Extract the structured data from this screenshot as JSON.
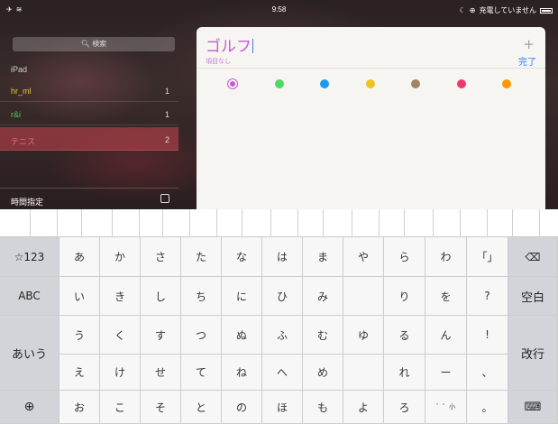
{
  "status_bar": {
    "time": "9:58",
    "charging": "充電していません"
  },
  "sidebar": {
    "search_placeholder": "検索",
    "section_label": "iPad",
    "lists": [
      {
        "name": "hr_ml",
        "count": "1",
        "color": "#e9c53a"
      },
      {
        "name": "r&i",
        "count": "1",
        "color": "#4fcb5a"
      },
      {
        "name": "テニス",
        "count": "2",
        "color": "#d75d7a"
      }
    ],
    "scheduled_label": "時間指定"
  },
  "editor": {
    "title": "ゴルフ",
    "subtitle": "項目なし",
    "add_symbol": "+",
    "done_label": "完了",
    "colors": [
      "#c45ad6",
      "#4cd964",
      "#1b9bf0",
      "#f0c21e",
      "#a2845e",
      "#f0386d",
      "#ff9500"
    ],
    "selected_color_index": 0
  },
  "keyboard": {
    "rows": [
      [
        "☆123",
        "あ",
        "か",
        "さ",
        "た",
        "な",
        "は",
        "ま",
        "や",
        "ら",
        "わ",
        "「」",
        "⌫"
      ],
      [
        "ABC",
        "い",
        "き",
        "し",
        "ち",
        "に",
        "ひ",
        "み",
        "",
        "り",
        "を",
        "?",
        "空白"
      ],
      [
        "あいう",
        "う",
        "く",
        "す",
        "つ",
        "ぬ",
        "ふ",
        "む",
        "ゆ",
        "る",
        "ん",
        "!",
        "改行"
      ],
      [
        "",
        "え",
        "け",
        "せ",
        "て",
        "ね",
        "へ",
        "め",
        "",
        "れ",
        "ー",
        "、",
        ""
      ],
      [
        "globe",
        "お",
        "こ",
        "そ",
        "と",
        "の",
        "ほ",
        "も",
        "よ",
        "ろ",
        "゛゜小",
        "。",
        "keyboard"
      ]
    ]
  },
  "colors": {
    "accent": "#2b7de9",
    "title_purple": "#c45ad6",
    "selected_list": "#c84650"
  }
}
